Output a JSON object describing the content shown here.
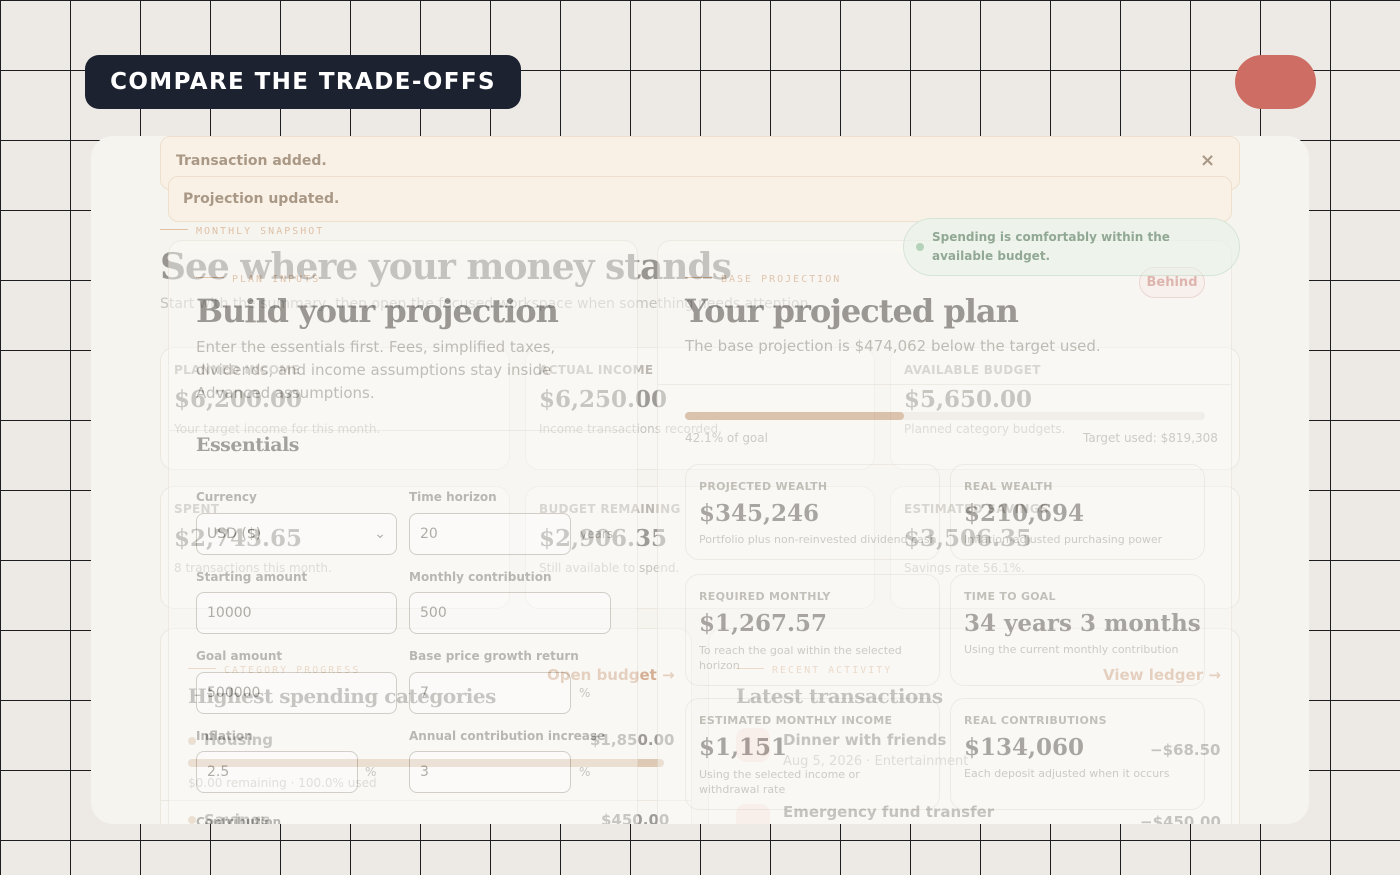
{
  "banner": {
    "title": "COMPARE THE TRADE-OFFS"
  },
  "toasts": {
    "transaction": "Transaction added.",
    "projection": "Projection updated.",
    "close_icon": "×",
    "budget_status": "Spending is comfortably within the available budget."
  },
  "snapshot": {
    "kicker": "MONTHLY SNAPSHOT",
    "title": "See where your money stands",
    "subtitle": "Start with the summary, then open the focused workspace when something needs attention.",
    "cards": [
      {
        "label": "PLANNED INCOME",
        "value": "$6,200.00",
        "note": "Your target income for this month."
      },
      {
        "label": "ACTUAL INCOME",
        "value": "$6,250.00",
        "note": "Income transactions recorded."
      },
      {
        "label": "AVAILABLE BUDGET",
        "value": "$5,650.00",
        "note": "Planned category budgets."
      },
      {
        "label": "SPENT",
        "value": "$2,743.65",
        "note": "8 transactions this month."
      },
      {
        "label": "BUDGET REMAINING",
        "value": "$2,906.35",
        "note": "Still available to spend."
      },
      {
        "label": "ESTIMATED SAVINGS",
        "value": "$3,506.35",
        "note": "Savings rate 56.1%."
      }
    ]
  },
  "categories": {
    "kicker": "CATEGORY PROGRESS",
    "title": "Highest spending categories",
    "link": "Open budget →",
    "items": [
      {
        "name": "Housing",
        "amount": "$1,850.00",
        "note": "$0.00 remaining · 100.0% used",
        "progress": 1.0
      },
      {
        "name": "Savings",
        "amount": "$450.00"
      }
    ]
  },
  "activity": {
    "kicker": "RECENT ACTIVITY",
    "title": "Latest transactions",
    "link": "View ledger →",
    "items": [
      {
        "name": "Dinner with friends",
        "meta": "Aug 5, 2026 · Entertainment",
        "amount": "−$68.50"
      },
      {
        "name": "Emergency fund transfer",
        "amount": "−$450.00"
      }
    ]
  },
  "plan_inputs": {
    "kicker": "PLAN INPUTS",
    "title": "Build your projection",
    "subtitle": "Enter the essentials first. Fees, simplified taxes, dividends, and income assumptions stay inside Advanced assumptions.",
    "section": "Essentials",
    "currency": {
      "label": "Currency",
      "value": "USD ($)"
    },
    "horizon": {
      "label": "Time horizon",
      "value": "20",
      "unit": "years"
    },
    "starting": {
      "label": "Starting amount",
      "value": "10000"
    },
    "monthly": {
      "label": "Monthly contribution",
      "value": "500"
    },
    "goal": {
      "label": "Goal amount",
      "value": "500000"
    },
    "growth": {
      "label": "Base price growth return",
      "value": "7",
      "unit": "%"
    },
    "inflation": {
      "label": "Inflation",
      "value": "2.5",
      "unit": "%"
    },
    "increase": {
      "label": "Annual contribution increase",
      "value": "3",
      "unit": "%"
    },
    "truncated": "Contribution"
  },
  "projection": {
    "kicker": "BASE PROJECTION",
    "title": "Your projected plan",
    "subtitle": "The base projection is $474,062 below the target used.",
    "badge": "Behind",
    "progress": 0.421,
    "progress_note": "42.1% of goal",
    "target_note": "Target used: $819,308",
    "cards": [
      {
        "label": "PROJECTED WEALTH",
        "value": "$345,246",
        "note": "Portfolio plus non-reinvested dividend cash"
      },
      {
        "label": "REAL WEALTH",
        "value": "$210,694",
        "note": "Inflation-adjusted purchasing power"
      },
      {
        "label": "REQUIRED MONTHLY",
        "value": "$1,267.57",
        "note": "To reach the goal within the selected horizon"
      },
      {
        "label": "TIME TO GOAL",
        "value": "34 years 3 months",
        "note": "Using the current monthly contribution"
      },
      {
        "label": "ESTIMATED MONTHLY INCOME",
        "value": "$1,151",
        "note": "Using the selected income or withdrawal rate"
      },
      {
        "label": "REAL CONTRIBUTIONS",
        "value": "$134,060",
        "note": "Each deposit adjusted when it occurs"
      }
    ]
  },
  "colors": {
    "accent": "#c78e5e",
    "badge": "#cd6d64",
    "banner": "#1c2230",
    "status": "#7fb58e"
  }
}
